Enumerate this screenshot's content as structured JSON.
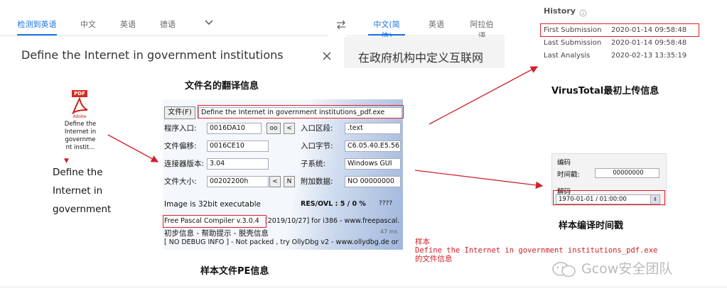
{
  "translator": {
    "source_tabs": [
      "检测到英语",
      "中文",
      "英语",
      "德语"
    ],
    "target_tabs": [
      "中文(简体)",
      "英语",
      "阿拉伯语"
    ],
    "swap_icon": "swap-arrows-icon",
    "source_text": "Define the Internet in government institutions",
    "target_text": "在政府机构中定义互联网",
    "clear_icon": "close-icon",
    "more_icon": "chevron-down-icon"
  },
  "history": {
    "title": "History",
    "info_icon": "info-icon",
    "rows": [
      {
        "label": "First Submission",
        "value": "2020-01-14 09:58:48"
      },
      {
        "label": "Last Submission",
        "value": "2020-01-14 09:58:48"
      },
      {
        "label": "Last Analysis",
        "value": "2020-02-13 13:35:19"
      }
    ]
  },
  "captions": {
    "filename_translation": "文件名的翻译信息",
    "virustotal": "VirusTotal最初上传信息",
    "pe_info": "样本文件PE信息",
    "compile_time": "样本编译时间戳"
  },
  "pdf_icon": {
    "badge": "PDF",
    "brand": "Adobe",
    "filename_lines": [
      "Define the",
      "Internet in",
      "governme",
      "nt instit..."
    ]
  },
  "expanded_name": [
    "Define the",
    "Internet in",
    "government"
  ],
  "pe": {
    "file_button": "文件(F)",
    "file_name": "Define the Internet in government institutions_pdf.exe",
    "entry_point_label": "程序入口:",
    "entry_point": "0016DA10",
    "oo_button": "oo",
    "lt_button": "<",
    "section_label": "入口区段:",
    "section": ".text",
    "file_offset_label": "文件偏移:",
    "file_offset": "0016CE10",
    "entry_bytes_label": "入口字节:",
    "entry_bytes": "C6.05.40.E5.56",
    "linker_label": "连接器版本:",
    "linker": "3.04",
    "subsystem_label": "子系统:",
    "subsystem": "Windows GUI",
    "size_label": "文件大小:",
    "size": "00202200h",
    "n_button": "N",
    "overlay_label": "附加数据:",
    "overlay": "NO  00000000",
    "bits_text": "Image is 32bit executable",
    "res_ovl": "RES/OVL : 5 / 0 %",
    "qmarks": "????",
    "compiler": "Free Pascal Compiler v.3.0.4",
    "compiler_rest": "[2019/10/27] for i386 - www.freepascal.",
    "hint_line": "初步信息 - 帮助提示 - 脱壳信息",
    "ms": "47 ms",
    "debug_line": "[ NO DEBUG INFO ] - Not packed , try OllyDbg v2 - www.ollydbg.de or"
  },
  "timestamp": {
    "encode_label": "编码",
    "ts_label": "时间戳:",
    "ts_value": "00000000",
    "decode_label": "解码",
    "decoded": "1970-01-01  /  01:00:00"
  },
  "sample_note": [
    "样本",
    "Define the Internet in government institutions_pdf.exe",
    "的文件信息"
  ],
  "watermark": "Gcow安全团队",
  "colors": {
    "accent": "#1a73e8",
    "highlight": "#e0202a"
  }
}
